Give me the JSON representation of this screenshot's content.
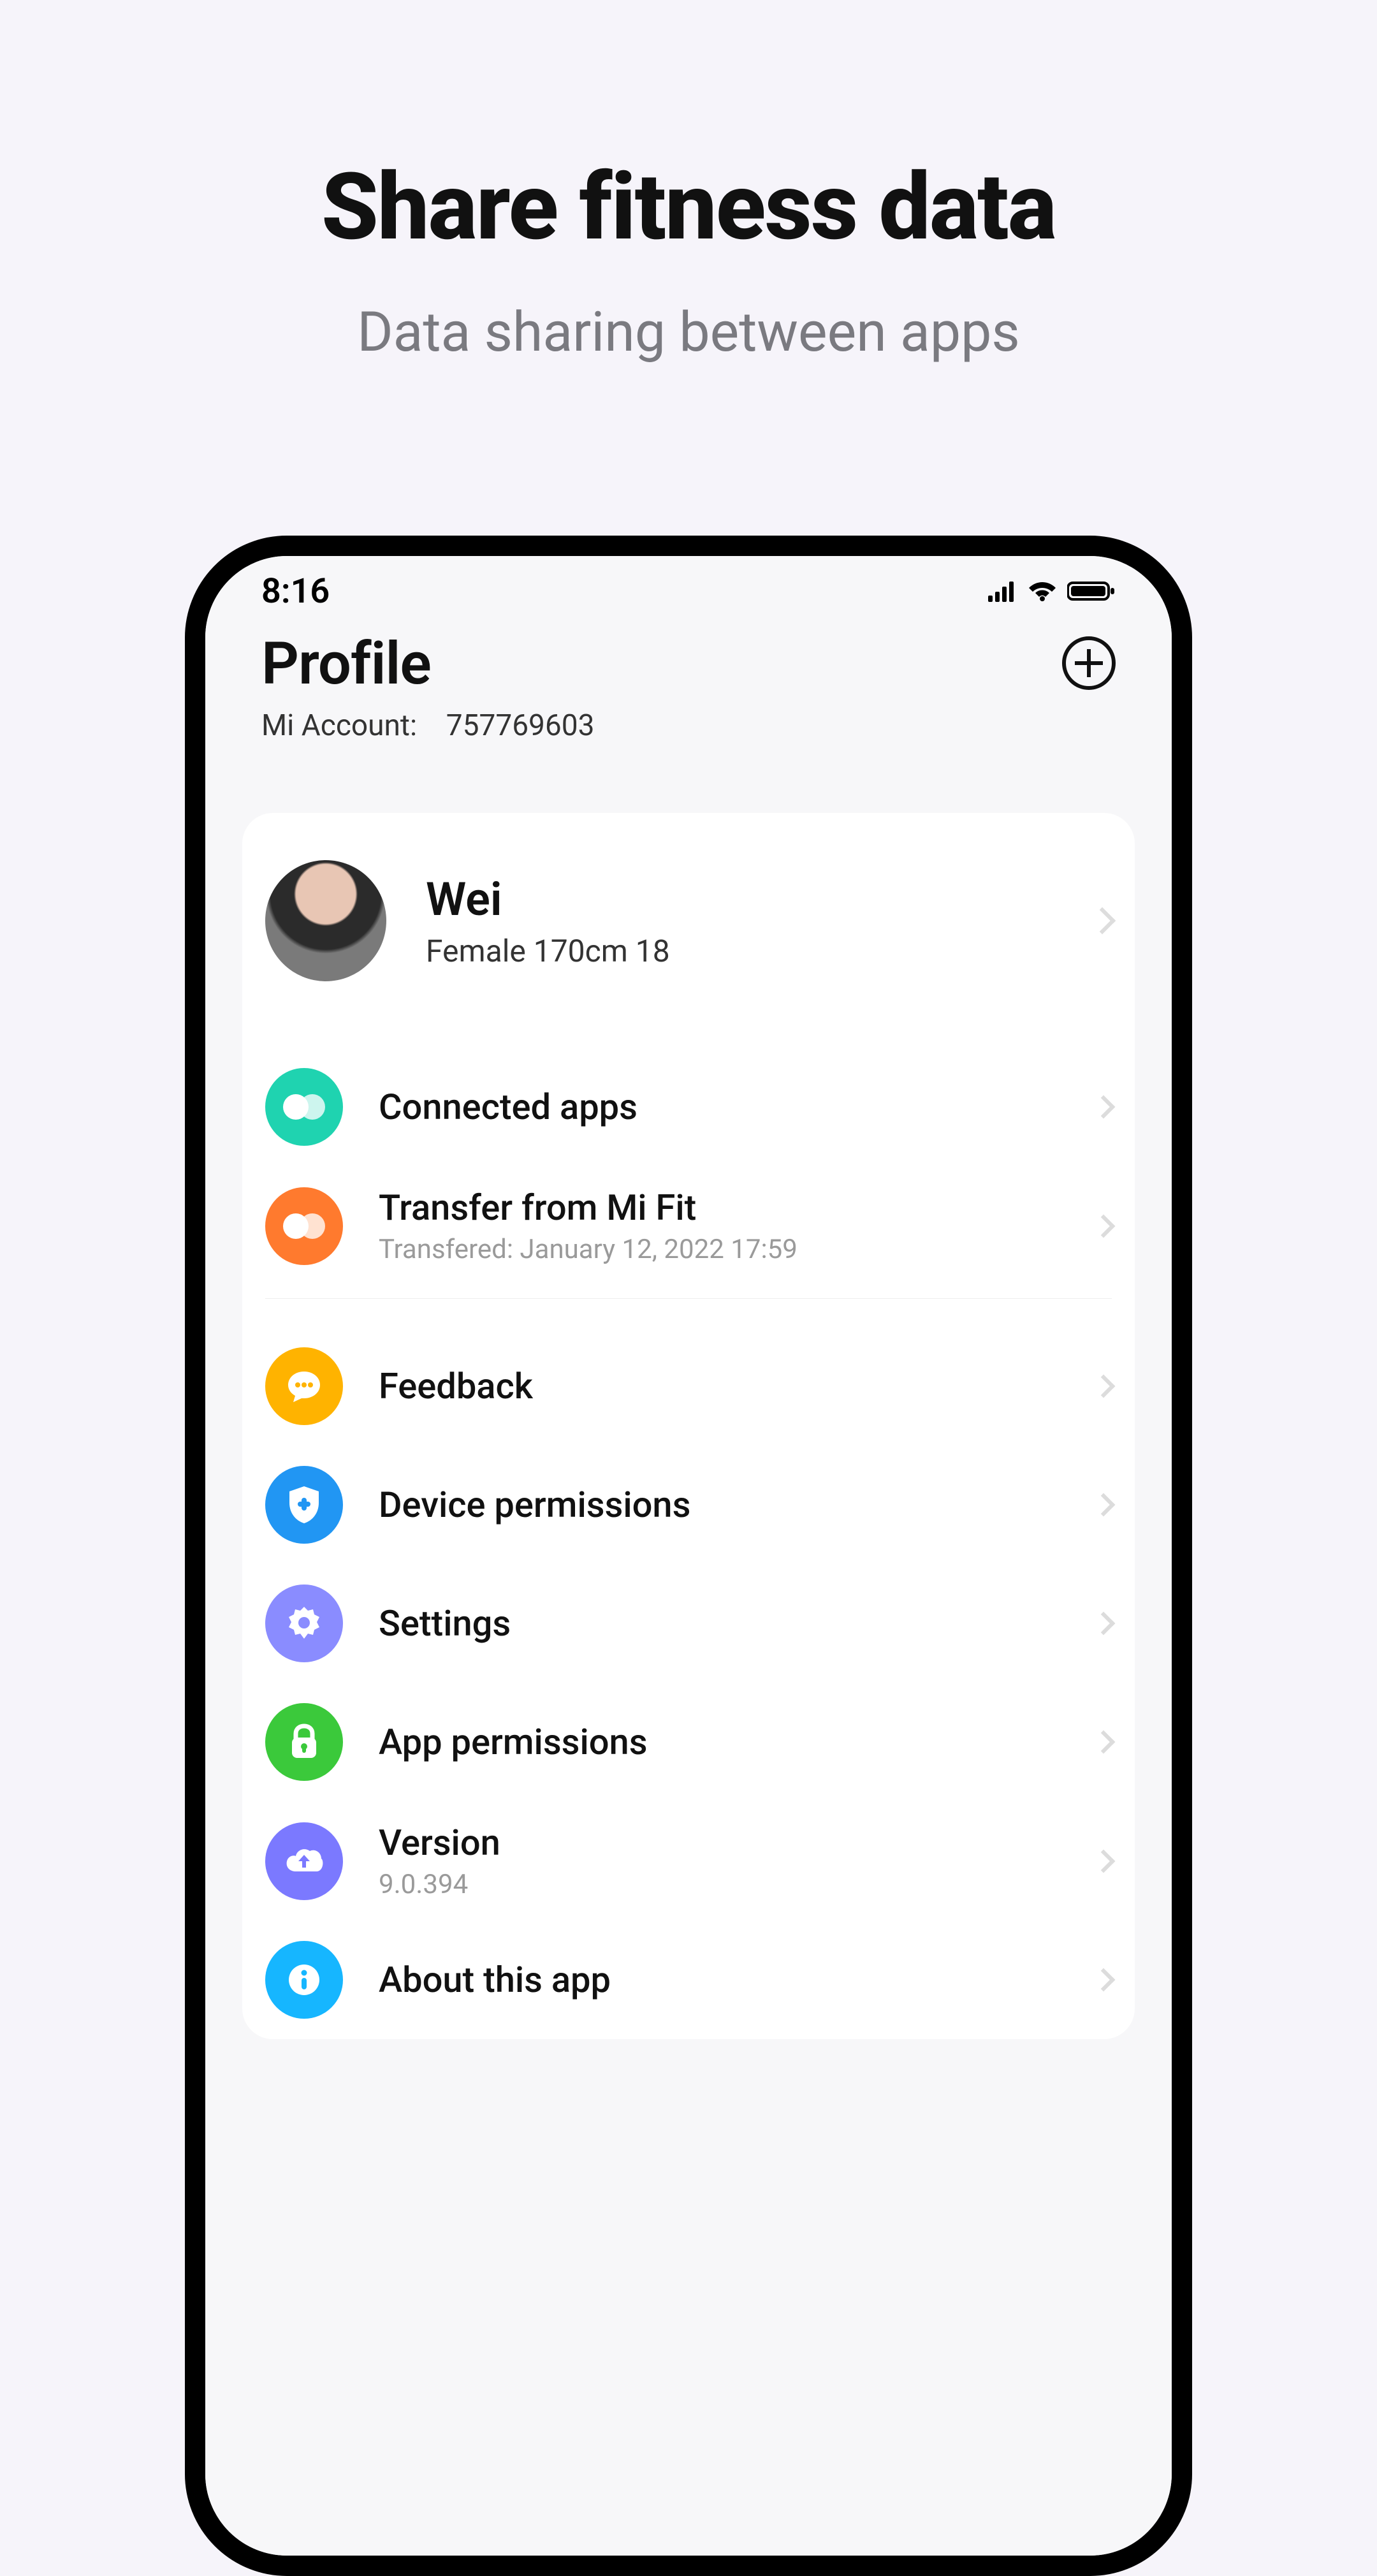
{
  "promo": {
    "title": "Share fitness data",
    "subtitle": "Data sharing between apps"
  },
  "statusbar": {
    "time": "8:16"
  },
  "header": {
    "title": "Profile",
    "account_label": "Mi Account:",
    "account_id": "757769603"
  },
  "user": {
    "name": "Wei",
    "meta": "Female 170cm  18"
  },
  "rows": {
    "connected_apps": {
      "label": "Connected apps"
    },
    "transfer": {
      "label": "Transfer from Mi Fit",
      "sub": "Transfered: January 12,  2022 17:59"
    },
    "feedback": {
      "label": "Feedback"
    },
    "device_perm": {
      "label": "Device permissions"
    },
    "settings": {
      "label": "Settings"
    },
    "app_perm": {
      "label": "App permissions"
    },
    "version": {
      "label": "Version",
      "sub": "9.0.394"
    },
    "about": {
      "label": "About this app"
    }
  }
}
